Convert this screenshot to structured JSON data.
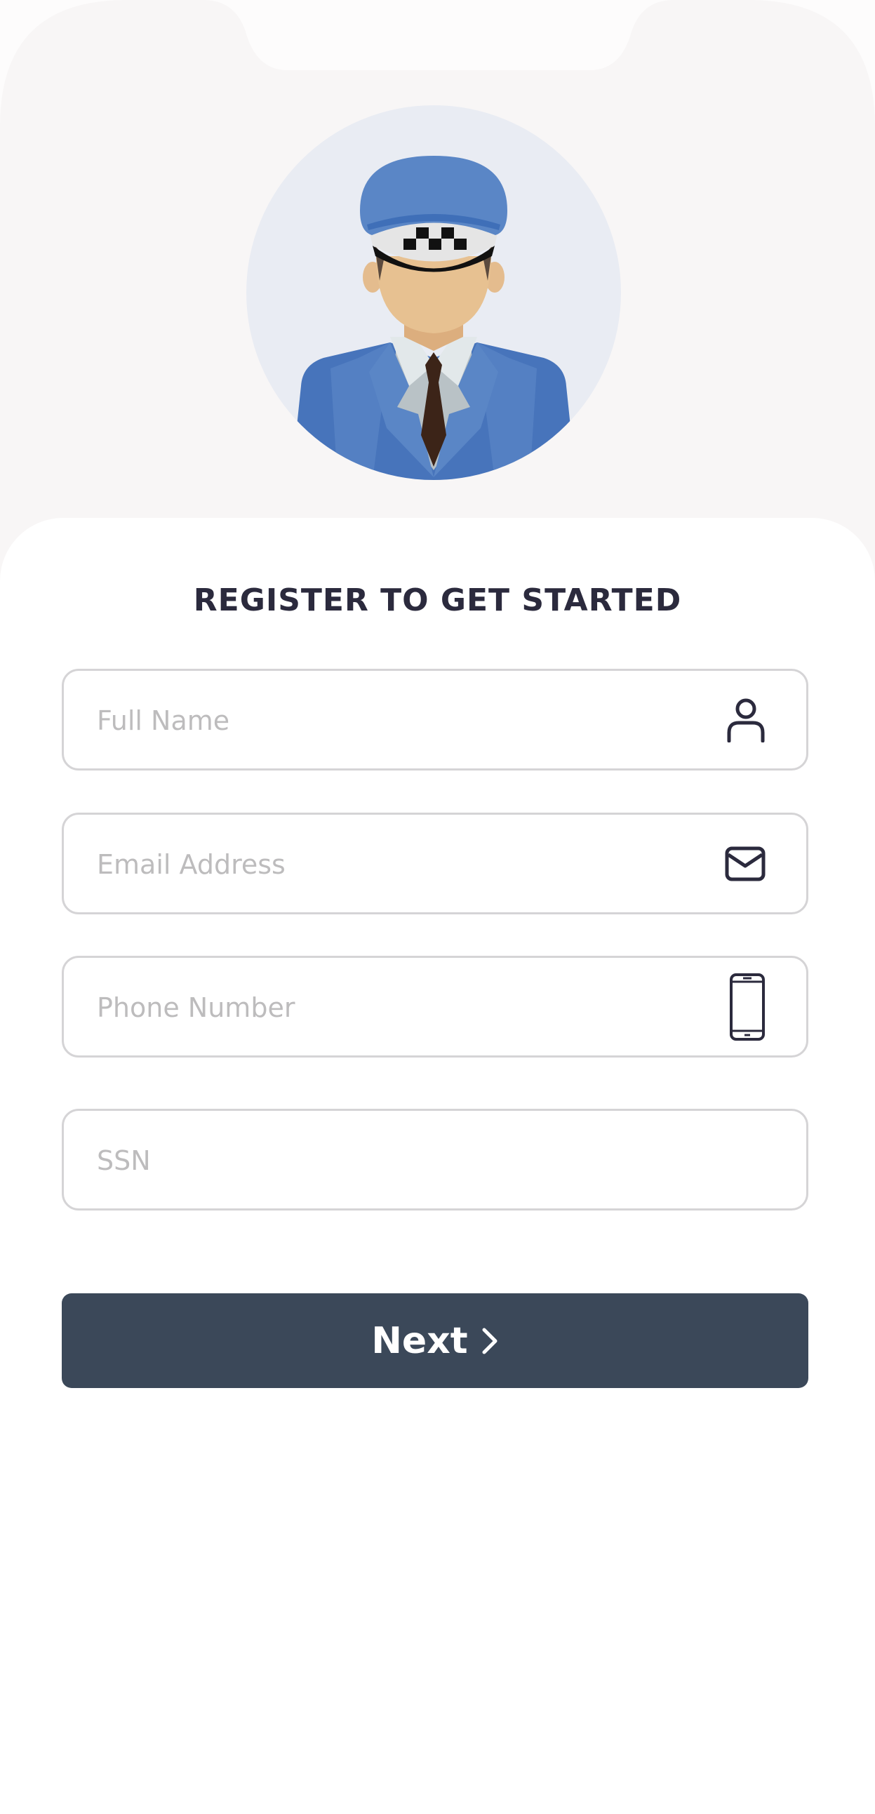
{
  "header": {
    "avatar_name": "taxi-driver-avatar-icon"
  },
  "form": {
    "title": "REGISTER TO GET STARTED",
    "fields": [
      {
        "placeholder": "Full Name",
        "icon": "user-icon"
      },
      {
        "placeholder": "Email Address",
        "icon": "mail-icon"
      },
      {
        "placeholder": "Phone Number",
        "icon": "phone-icon"
      },
      {
        "placeholder": "SSN",
        "icon": ""
      }
    ],
    "next_label": "Next"
  },
  "colors": {
    "background": "#f8f6f6",
    "card": "#ffffff",
    "title": "#2b2a3d",
    "button": "#3b4859",
    "field_border": "#d5d4d6",
    "placeholder": "#bdbcbd",
    "icon": "#2b2a3d"
  }
}
